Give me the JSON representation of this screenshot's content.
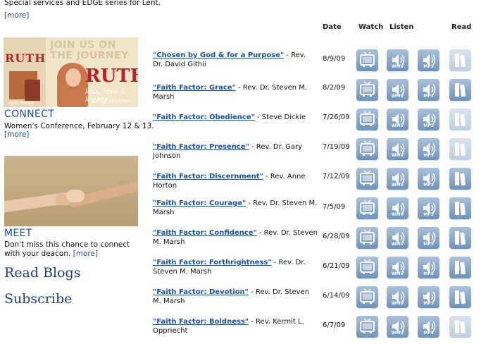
{
  "left": {
    "top_desc": "Special services and EDGE series for Lent.",
    "more_label": "[more]",
    "promo": {
      "ruth_small": "RUTH",
      "join": "JOIN US ON THE JOURNEY",
      "ruth_big": "RUTH",
      "tagline": "loss, love & legacy",
      "author_small": "kelly minter",
      "author_large": "kelly minter"
    },
    "connect": {
      "title": "CONNECT",
      "desc": "Women's Conference, February 12 & 13."
    },
    "meet": {
      "title": "MEET",
      "desc": "Don't miss this chance to connect with your deacon."
    },
    "read_blogs": "Read Blogs",
    "subscribe": "Subscribe"
  },
  "table": {
    "headers": {
      "date": "Date",
      "watch": "Watch",
      "listen": "Listen",
      "read": "Read"
    },
    "icon_labels": {
      "wmv": "WMV",
      "mp3": "MP3"
    },
    "rows": [
      {
        "title": "\"Chosen by God & for a Purpose\"",
        "speaker": " - Rev. Dr. David Githii",
        "date": "8/9/09",
        "read_enabled": false
      },
      {
        "title": "\"Faith Factor: Grace\"",
        "speaker": " - Rev. Dr. Steven M. Marsh",
        "date": "8/2/09",
        "read_enabled": true
      },
      {
        "title": "\"Faith Factor: Obedience\"",
        "speaker": " - Steve Dickie",
        "date": "7/26/09",
        "read_enabled": false
      },
      {
        "title": "\"Faith Factor: Presence\"",
        "speaker": " - Rev. Dr. Gary Johnson",
        "date": "7/19/09",
        "read_enabled": false
      },
      {
        "title": "\"Faith Factor: Discernment\"",
        "speaker": " - Rev. Anne Horton",
        "date": "7/12/09",
        "read_enabled": true
      },
      {
        "title": "\"Faith Factor: Courage\"",
        "speaker": " - Rev. Dr. Steven M. Marsh",
        "date": "7/5/09",
        "read_enabled": true
      },
      {
        "title": "\"Faith Factor: Confidence\"",
        "speaker": " - Rev. Dr. Steven M. Marsh",
        "date": "6/28/09",
        "read_enabled": true
      },
      {
        "title": "\"Faith Factor: Forthrightness\"",
        "speaker": " - Rev. Dr. Steven M. Marsh",
        "date": "6/21/09",
        "read_enabled": true
      },
      {
        "title": "\"Faith Factor: Devotion\"",
        "speaker": " - Rev. Dr. Steven M. Marsh",
        "date": "6/14/09",
        "read_enabled": true
      },
      {
        "title": "\"Faith Factor: Boldness\"",
        "speaker": " - Rev. Kermit L. Oppriecht",
        "date": "6/7/09",
        "read_enabled": false
      }
    ]
  }
}
